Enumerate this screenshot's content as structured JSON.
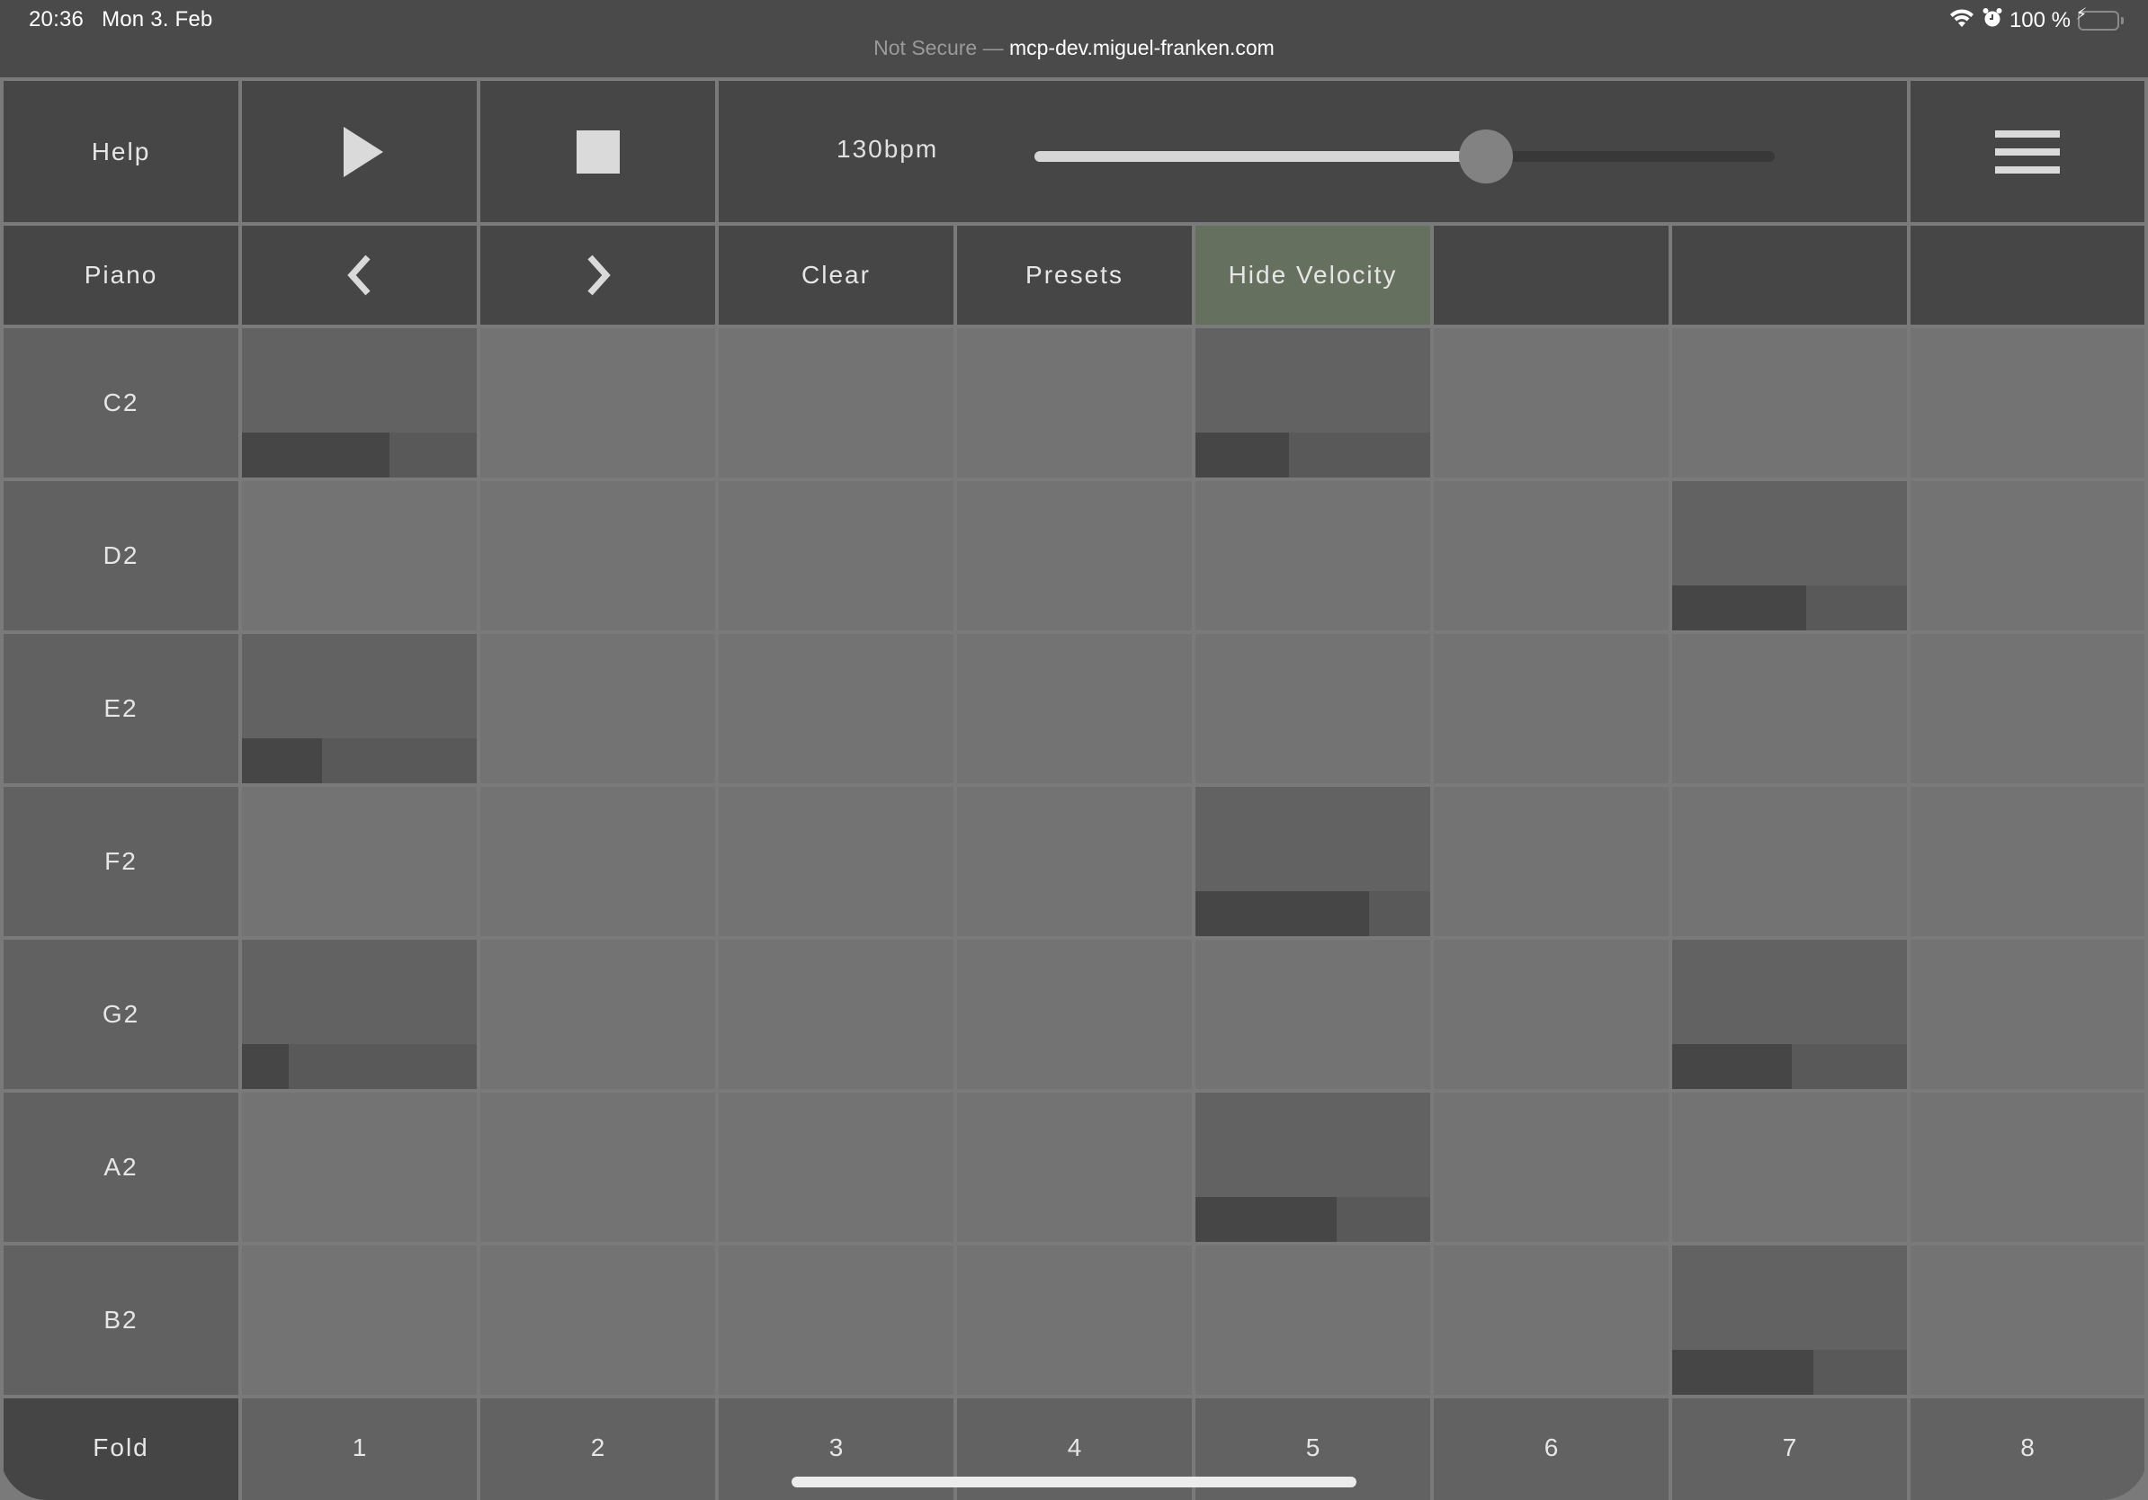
{
  "status_bar": {
    "time": "20:36",
    "date": "Mon 3. Feb",
    "security_label": "Not Secure —",
    "host": "mcp-dev.miguel-franken.com",
    "battery_percent": "100 %",
    "icons": [
      "wifi-icon",
      "alarm-icon",
      "battery-charging-icon"
    ]
  },
  "toolbar": {
    "help_label": "Help",
    "play_icon": "play-icon",
    "stop_icon": "stop-icon",
    "tempo": {
      "label": "130bpm",
      "bpm": 130,
      "slider_fraction": 0.61
    },
    "menu_icon": "hamburger-menu-icon"
  },
  "controls": {
    "instrument_label": "Piano",
    "prev_icon": "chevron-left-icon",
    "next_icon": "chevron-right-icon",
    "clear_label": "Clear",
    "presets_label": "Presets",
    "velocity_toggle_label": "Hide Velocity",
    "velocity_toggle_color": "#65705f"
  },
  "grid": {
    "notes": [
      "C2",
      "D2",
      "E2",
      "F2",
      "G2",
      "A2",
      "B2"
    ],
    "steps": [
      "1",
      "2",
      "3",
      "4",
      "5",
      "6",
      "7",
      "8"
    ],
    "active_notes": [
      {
        "note": "C2",
        "step": 1,
        "velocity": 0.63
      },
      {
        "note": "C2",
        "step": 5,
        "velocity": 0.4
      },
      {
        "note": "D2",
        "step": 7,
        "velocity": 0.57
      },
      {
        "note": "E2",
        "step": 1,
        "velocity": 0.34
      },
      {
        "note": "F2",
        "step": 5,
        "velocity": 0.74
      },
      {
        "note": "G2",
        "step": 1,
        "velocity": 0.2
      },
      {
        "note": "G2",
        "step": 7,
        "velocity": 0.51
      },
      {
        "note": "A2",
        "step": 5,
        "velocity": 0.6
      },
      {
        "note": "B2",
        "step": 7,
        "velocity": 0.6
      }
    ]
  },
  "footer": {
    "fold_label": "Fold"
  }
}
